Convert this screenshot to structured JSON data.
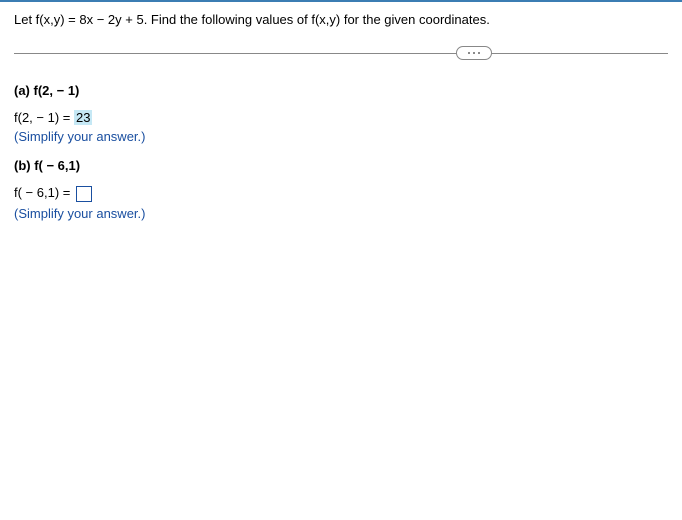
{
  "problem": "Let f(x,y) = 8x − 2y + 5. Find the following values of f(x,y) for the given coordinates.",
  "partA": {
    "label": "(a) f(2, − 1)",
    "expression": "f(2, − 1) =",
    "answer": "23",
    "instruction": "(Simplify your answer.)"
  },
  "partB": {
    "label": "(b) f( − 6,1)",
    "expression": "f( − 6,1) =",
    "instruction": "(Simplify your answer.)"
  }
}
